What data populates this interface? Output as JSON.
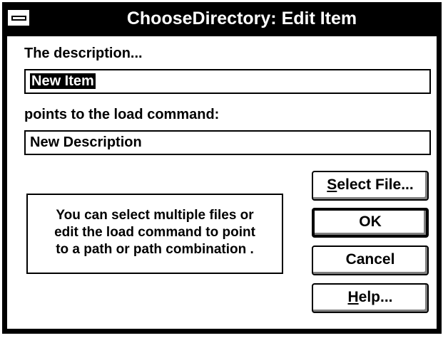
{
  "window": {
    "title": "ChooseDirectory: Edit Item"
  },
  "description": {
    "label": "The description...",
    "value": "New Item"
  },
  "command": {
    "label": "points to the load command:",
    "value": "New Description"
  },
  "note": {
    "text": "You can select multiple files or\nedit the load command to point\nto a path or path combination ."
  },
  "buttons": {
    "select_file": {
      "mnemonic": "S",
      "rest": "elect File..."
    },
    "ok": "OK",
    "cancel": "Cancel",
    "help": {
      "mnemonic": "H",
      "rest": "elp..."
    }
  },
  "icons": {
    "system_menu": "system-menu-icon"
  }
}
